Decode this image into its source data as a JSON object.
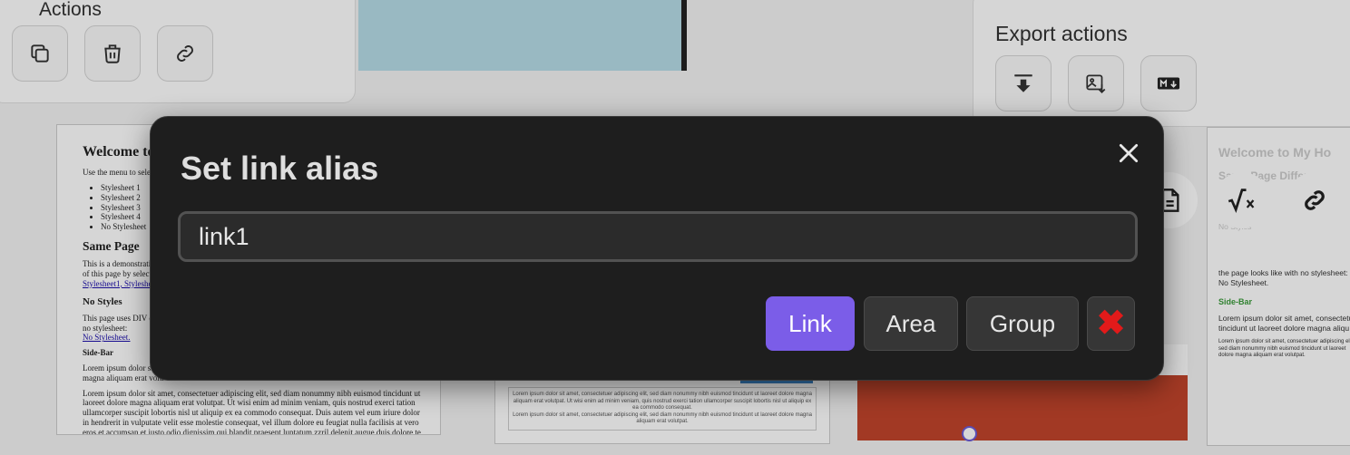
{
  "background": {
    "actions_panel": {
      "title": "Actions",
      "buttons": [
        "duplicate-icon",
        "trash-icon",
        "link-icon"
      ]
    },
    "export_panel": {
      "title": "Export actions",
      "buttons": [
        "download-icon",
        "export-image-icon",
        "markdown-icon"
      ]
    },
    "page1": {
      "heading": "Welcome to",
      "intro": "Use the menu to select a",
      "stylesheets": [
        "Stylesheet 1",
        "Stylesheet 2",
        "Stylesheet 3",
        "Stylesheet 4",
        "No Stylesheet"
      ],
      "same_page_heading": "Same Page",
      "demo_text": "This is a demonstration",
      "demo_text2": "of this page by selecting",
      "stylesheet_links": "Stylesheet1, Stylesheet2,",
      "no_styles_heading": "No Styles",
      "no_styles_text": "This page uses DIV ele",
      "no_styles_text2": "no stylesheet:",
      "no_stylesheet_link": "No Stylesheet.",
      "sidebar_heading": "Side-Bar",
      "lorem1": "Lorem ipsum dolor sit",
      "lorem2": "magna aliquam erat volu",
      "lorem_long": "Lorem ipsum dolor sit amet, consectetuer adipiscing elit, sed diam nonummy nibh euismod tincidunt ut laoreet dolore magna aliquam erat volutpat. Ut wisi enim ad minim veniam, quis nostrud exerci tation ullamcorper suscipit lobortis nisl ut aliquip ex ea commodo consequat. Duis autem vel eum iriure dolor in hendrerit in vulputate velit esse molestie consequat, vel illum dolore eu feugiat nulla facilisis at vero eros et accumsan et iusto odio dignissim qui blandit praesent luptatum zzril delenit augue duis dolore te feugait nulla facilisi."
    },
    "page2": {
      "text1": "Lorem ipsum dolor sit amet, consectetuer adipiscing elit, sed diam nonummy nibh euismod tincidunt ut laoreet dolore magna aliquam erat volutpat. Ut wisi enim ad minim veniam, quis nostrud exerci tation ullamcorper suscipit lobortis nisl ut aliquip ex ea commodo consequat.",
      "text2": "Lorem ipsum dolor sit amet, consectetuer adipiscing elit, sed diam nonummy nibh euismod tincidunt ut laoreet dolore magna aliquam erat volutpat."
    },
    "page4": {
      "title": "Welcome to My Ho",
      "subtitle": "Same Page Differe",
      "no_styles": "No Styles",
      "line1": "the page looks like with no stylesheet:",
      "line2": "No Stylesheet.",
      "sidebar": "Side-Bar",
      "lorem1": "Lorem ipsum dolor sit amet, consectetue",
      "lorem2": "tincidunt ut laoreet dolore magna aliqu",
      "lorem3": "Lorem ipsum dolor sit amet, consectetuer adipiscing elit, sed diam nonummy nibh euismod tincidunt ut laoreet dolore magna aliquam erat volutpat."
    },
    "round_icons": [
      "document-icon",
      "formula-icon",
      "link-icon"
    ]
  },
  "dialog": {
    "title": "Set link alias",
    "input_value": "link1",
    "buttons": {
      "link": "Link",
      "area": "Area",
      "group": "Group",
      "cancel": "✖"
    },
    "colors": {
      "primary": "#7b5de8",
      "cancel_x": "#e21a1a",
      "background": "#1e1e1e"
    }
  }
}
